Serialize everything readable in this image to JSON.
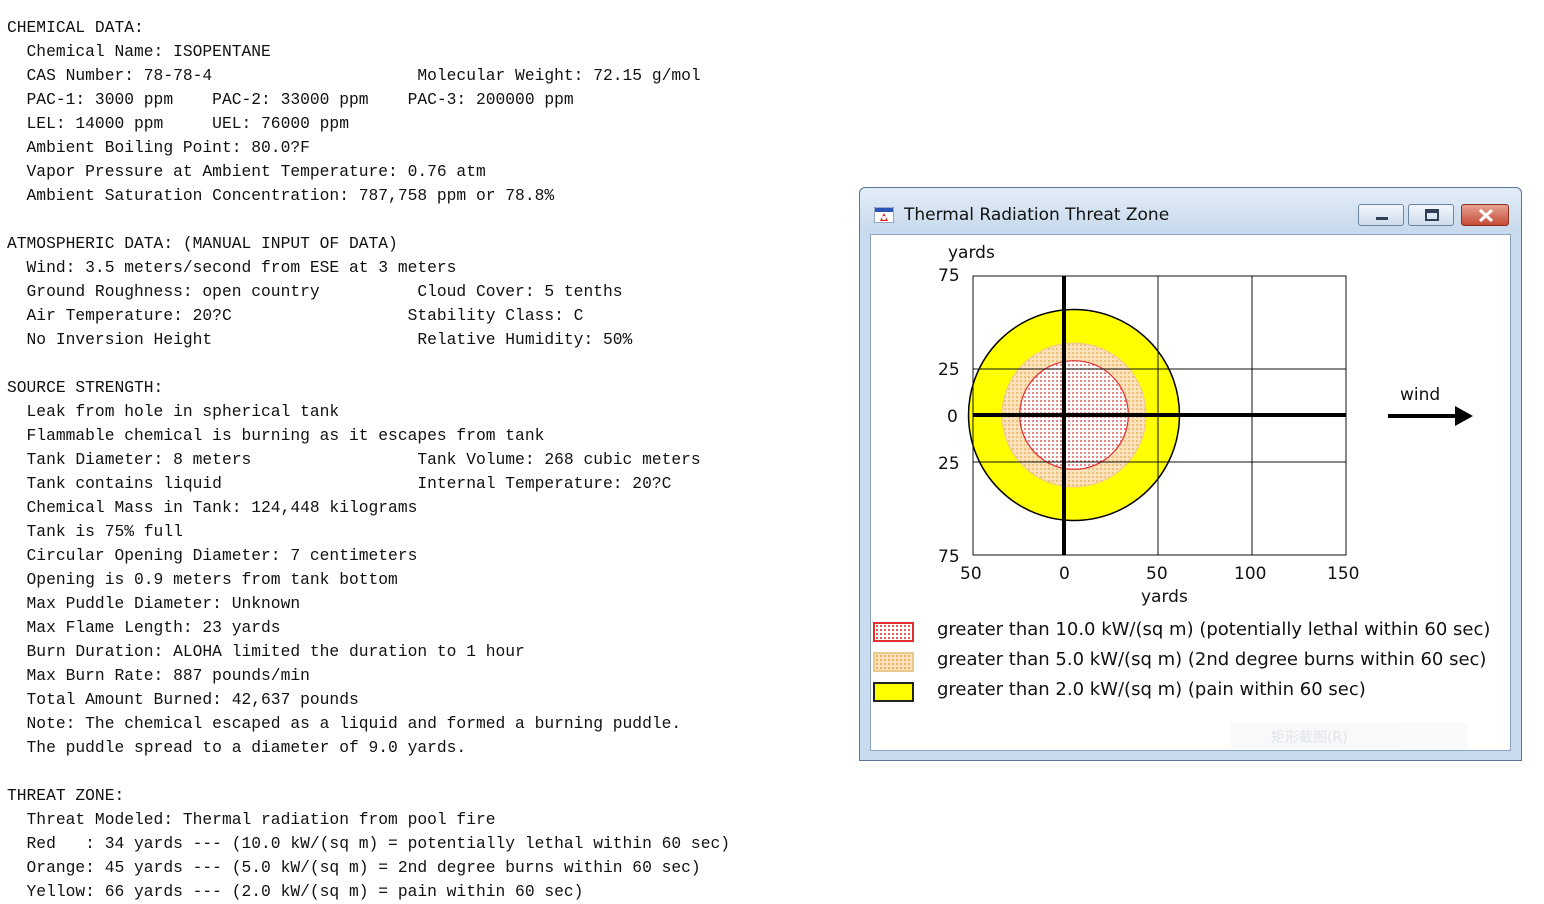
{
  "report": {
    "lines": [
      "CHEMICAL DATA:",
      "  Chemical Name: ISOPENTANE",
      "  CAS Number: 78-78-4                     Molecular Weight: 72.15 g/mol",
      "  PAC-1: 3000 ppm    PAC-2: 33000 ppm    PAC-3: 200000 ppm",
      "  LEL: 14000 ppm     UEL: 76000 ppm",
      "  Ambient Boiling Point: 80.0?F",
      "  Vapor Pressure at Ambient Temperature: 0.76 atm",
      "  Ambient Saturation Concentration: 787,758 ppm or 78.8%",
      "",
      "ATMOSPHERIC DATA: (MANUAL INPUT OF DATA)",
      "  Wind: 3.5 meters/second from ESE at 3 meters",
      "  Ground Roughness: open country          Cloud Cover: 5 tenths",
      "  Air Temperature: 20?C                  Stability Class: C",
      "  No Inversion Height                     Relative Humidity: 50%",
      "",
      "SOURCE STRENGTH:",
      "  Leak from hole in spherical tank",
      "  Flammable chemical is burning as it escapes from tank",
      "  Tank Diameter: 8 meters                 Tank Volume: 268 cubic meters",
      "  Tank contains liquid                    Internal Temperature: 20?C",
      "  Chemical Mass in Tank: 124,448 kilograms",
      "  Tank is 75% full",
      "  Circular Opening Diameter: 7 centimeters",
      "  Opening is 0.9 meters from tank bottom",
      "  Max Puddle Diameter: Unknown",
      "  Max Flame Length: 23 yards",
      "  Burn Duration: ALOHA limited the duration to 1 hour",
      "  Max Burn Rate: 887 pounds/min",
      "  Total Amount Burned: 42,637 pounds",
      "  Note: The chemical escaped as a liquid and formed a burning puddle.",
      "  The puddle spread to a diameter of 9.0 yards.",
      "",
      "THREAT ZONE:",
      "  Threat Modeled: Thermal radiation from pool fire",
      "  Red   : 34 yards --- (10.0 kW/(sq m) = potentially lethal within 60 sec)",
      "  Orange: 45 yards --- (5.0 kW/(sq m) = 2nd degree burns within 60 sec)",
      "  Yellow: 66 yards --- (2.0 kW/(sq m) = pain within 60 sec)"
    ]
  },
  "window": {
    "title": "Thermal Radiation Threat Zone",
    "icon": "aloha-app-icon",
    "controls": [
      "minimize",
      "maximize",
      "close"
    ],
    "ghost_text": "矩形截图(R)"
  },
  "plot": {
    "y_unit": "yards",
    "x_unit": "yards",
    "y_ticks": [
      "75",
      "25",
      "0",
      "25",
      "75"
    ],
    "x_ticks": [
      "50",
      "0",
      "50",
      "100",
      "150"
    ],
    "wind_label": "wind",
    "colors": {
      "red": "#e23030",
      "orange": "#f6c27e",
      "yellow": "#ffff00"
    }
  },
  "chart_data": {
    "type": "scatter",
    "title": "Thermal Radiation Threat Zone",
    "xlabel": "yards",
    "ylabel": "yards",
    "zones": [
      {
        "name": "Red",
        "radius_yards": 34,
        "threshold": "10.0 kW/(sq m)"
      },
      {
        "name": "Orange",
        "radius_yards": 45,
        "threshold": "5.0 kW/(sq m)"
      },
      {
        "name": "Yellow",
        "radius_yards": 66,
        "threshold": "2.0 kW/(sq m)"
      }
    ],
    "legend": [
      "greater than 10.0 kW/(sq m) (potentially lethal within 60 sec)",
      "greater than 5.0 kW/(sq m) (2nd degree burns within 60 sec)",
      "greater than 2.0 kW/(sq m) (pain within 60 sec)"
    ]
  }
}
